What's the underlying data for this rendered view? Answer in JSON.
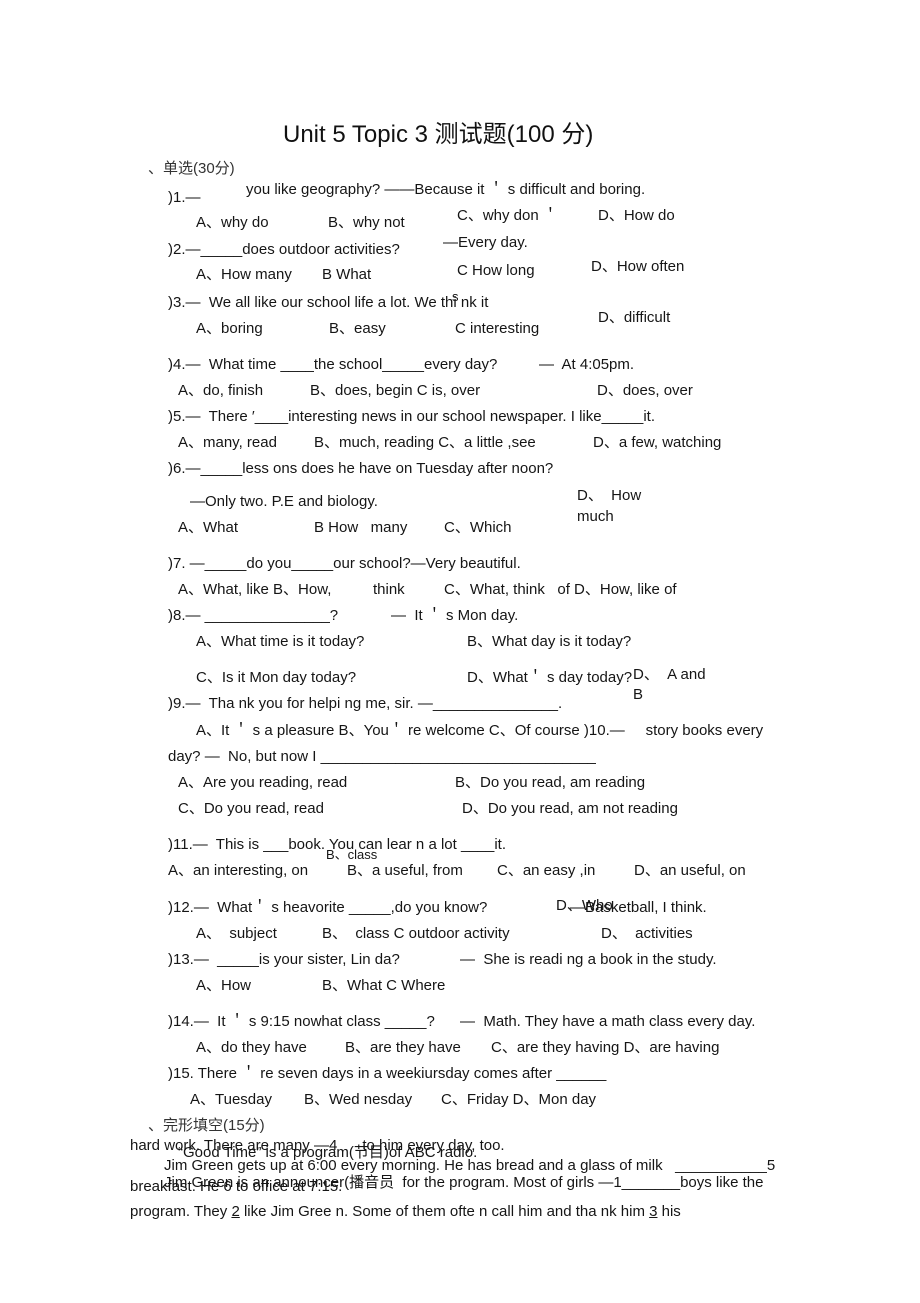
{
  "document": {
    "title": "Unit 5 Topic 3 测试题(100 分)",
    "section1": "、单选(30分)",
    "questions": [
      {
        "num": ")1.—",
        "stem": "you like geography? ——Because it ＇ s difficult and boring.",
        "options": [
          "A、why do",
          "B、why not",
          "C、why don ＇",
          "D、How do"
        ]
      },
      {
        "num": ")2.—_____does outdoor activities?",
        "answer_line": "—Every day.",
        "options": [
          "A、How many",
          "B What",
          "C How long",
          "D、How often"
        ]
      },
      {
        "num": ")3.—  We all like our school life a lot. We thi nk it",
        "stray": "s",
        "options": [
          "A、boring",
          "B、easy",
          "C interesting",
          "D、difficult"
        ]
      },
      {
        "num": ")4.—  What time ____the school_____every day?",
        "answer_line": "—  At 4:05pm.",
        "options": [
          "A、do, finish",
          "B、does, begin C is, over",
          "D、does, over"
        ]
      },
      {
        "num": ")5.—  There ′____interesting news in our school newspaper. I like_____it.",
        "options": [
          "A、many, read",
          "B、much, reading C、a little ,see",
          "D、a few, watching"
        ]
      },
      {
        "num": ")6.—_____less ons does he have on Tuesday after noon?",
        "answer_line": "—Only two. P.E and biology.",
        "options": [
          "A、What",
          "B How   many",
          "C、Which",
          "D、  How",
          "much"
        ]
      },
      {
        "num": ")7. —_____do you_____our school?—Very beautiful.",
        "options": [
          "A、What, like B、How,",
          "think",
          "C、What, think   of D、How, like of"
        ]
      },
      {
        "num": ")8.— _______________?",
        "answer_line": "—  It ＇ s Mon day.",
        "options": [
          "A、What time is it today?",
          "B、What day is it today?",
          "C、Is it Mon day today?",
          "D、What＇ s day today?",
          "D、  A and",
          "B"
        ]
      },
      {
        "num": ")9.—  Tha nk you for helpi ng me, sir. —_______________.",
        "options": [
          "A、It ＇ s a pleasure B、You＇ re welcome C、Of course )10.—     story books every"
        ]
      },
      {
        "num": "day? —  No, but now I _________________________________",
        "options": [
          "A、Are you reading, read",
          "B、Do you read, am reading",
          "C、Do you read, read",
          "D、Do you read, am not reading"
        ]
      },
      {
        "num": ")11.—  This is ___book. You can lear n a lot ____it.",
        "stray": "B、class",
        "options": [
          "A、an interesting, on",
          "B、a useful, from",
          "C、an easy ,in",
          "D、an useful, on"
        ]
      },
      {
        "num": ")12.—  What＇ s heavorite _____,do you know?",
        "answer_line": "—Basketball, I think.",
        "stray": "D、Who",
        "options": [
          "A、  subject",
          "B、  class C outdoor activity",
          "D、  activities"
        ]
      },
      {
        "num": ")13.—  _____is your sister, Lin da?",
        "answer_line": "—  She is readi ng a book in the study.",
        "options": [
          "A、How",
          "B、What C Where"
        ]
      },
      {
        "num": ")14.—  It ＇ s 9:15 nowhat class _____?",
        "answer_line": "—  Math. They have a math class every day.",
        "options": [
          "A、do they have",
          "B、are they have",
          "C、are they having D、are having"
        ]
      },
      {
        "num": ")15. There ＇ re seven days in a weekiursday comes after ______",
        "options": [
          "A、Tuesday",
          "B、Wed nesday",
          "C、Friday D、Mon day"
        ]
      }
    ],
    "section2": "、完形填空(15分)",
    "cloze": {
      "line_overlap_a": "hard work. There are many —4      to him every day, too.",
      "line_overlap_b": "“Good Time” is a program(节目)of ABC radio.",
      "line2": "Jim Green gets up at 6:00 every morning. He has bread and a glass of milk   ___________5",
      "line3_a": "breakfast. He 6 to office at 7:15.",
      "line3_b": "Jim Green is an announcer(播音员  for the program. Most of girls —1_______boys like the",
      "line4_pre": "program. They ",
      "line4_n2": "2",
      "line4_mid": " like Jim Gree n. Some of them ofte n call him and tha nk him ",
      "line4_n3": "3",
      "line4_post": " his"
    }
  }
}
